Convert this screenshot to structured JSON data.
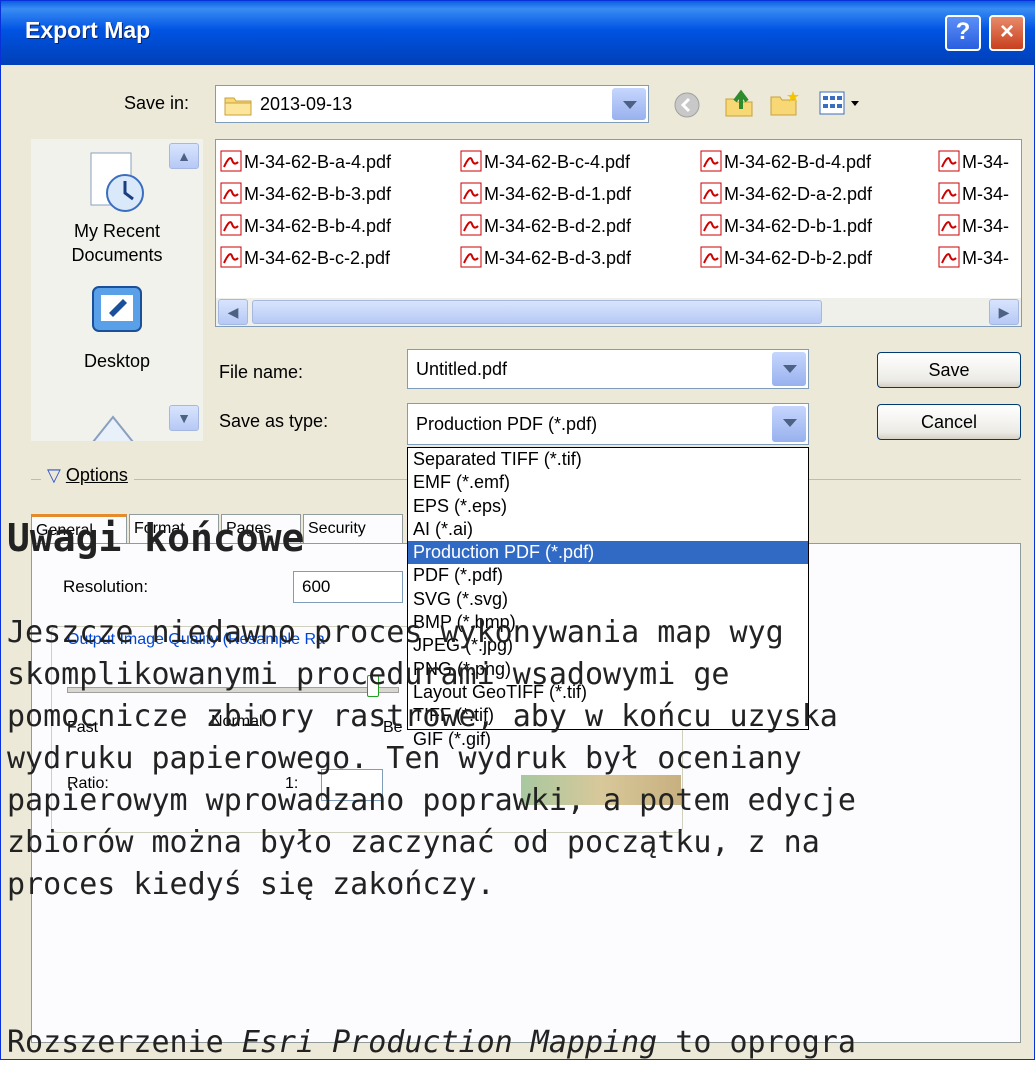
{
  "dialog": {
    "title": "Export Map",
    "help_button": "?",
    "close_button": "×"
  },
  "save_in": {
    "label": "Save in:",
    "value": "2013-09-13"
  },
  "places": [
    {
      "label_line1": "My Recent",
      "label_line2": "Documents",
      "icon": "recent-documents-icon"
    },
    {
      "label_line1": "Desktop",
      "label_line2": "",
      "icon": "desktop-icon"
    }
  ],
  "files": [
    [
      "M-34-62-B-a-4.pdf",
      "M-34-62-B-b-3.pdf",
      "M-34-62-B-b-4.pdf",
      "M-34-62-B-c-2.pdf"
    ],
    [
      "M-34-62-B-c-4.pdf",
      "M-34-62-B-d-1.pdf",
      "M-34-62-B-d-2.pdf",
      "M-34-62-B-d-3.pdf"
    ],
    [
      "M-34-62-B-d-4.pdf",
      "M-34-62-D-a-2.pdf",
      "M-34-62-D-b-1.pdf",
      "M-34-62-D-b-2.pdf"
    ],
    [
      "M-34-",
      "M-34-",
      "M-34-",
      "M-34-"
    ]
  ],
  "file_name": {
    "label": "File name:",
    "value": "Untitled.pdf"
  },
  "save_as_type": {
    "label": "Save as type:",
    "value": "Production PDF (*.pdf)",
    "options": [
      "Separated TIFF (*.tif)",
      "EMF (*.emf)",
      "EPS (*.eps)",
      "AI (*.ai)",
      "Production PDF (*.pdf)",
      "PDF (*.pdf)",
      "SVG (*.svg)",
      "BMP (*.bmp)",
      "JPEG (*.jpg)",
      "PNG (*.png)",
      "Layout GeoTIFF (*.tif)",
      "TIFF (*.tif)",
      "GIF (*.gif)"
    ],
    "selected_index": 4
  },
  "buttons": {
    "save": "Save",
    "cancel": "Cancel"
  },
  "options": {
    "label": "Options",
    "tabs": [
      "General",
      "Format",
      "Pages",
      "Security"
    ],
    "resolution_label": "Resolution:",
    "resolution_value": "600",
    "output_quality_label": "Output Image Quality (Resample Ra",
    "speed_labels": [
      "Fast",
      "Normal",
      "Be"
    ],
    "ratio_label": "Ratio:",
    "ratio_value": "1:"
  },
  "article": {
    "heading": "Uwagi końcowe",
    "lines": [
      "Jeszcze niedawno proces wykonywania map wyg",
      "skomplikowanymi procedurami  wsadowymi  ge",
      "pomocnicze zbiory rastrowe, aby w końcu uzyska",
      "wydruku papierowego. Ten wydruk był oceniany",
      "papierowym wprowadzano poprawki, a potem edycje",
      "zbiorów można było zaczynać od początku, z na",
      "proces kiedyś się zakończy."
    ],
    "last_line_prefix": "Rozszerzenie ",
    "last_line_emphasis": "Esri Production Mapping",
    "last_line_suffix": " to oprogra"
  }
}
